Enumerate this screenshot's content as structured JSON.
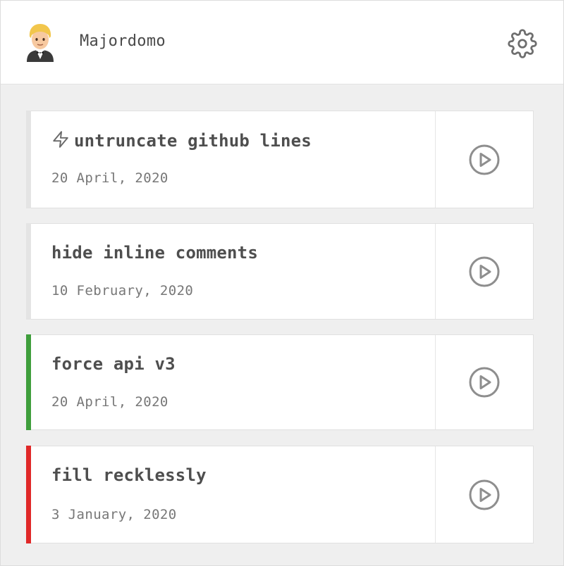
{
  "header": {
    "title": "Majordomo",
    "avatar_icon": "bellhop-person-icon",
    "settings_icon": "gear-icon"
  },
  "colors": {
    "neutral": "#e4e4e4",
    "green": "#3f9e3c",
    "red": "#e02828",
    "icon": "#8e8e8e"
  },
  "scripts": [
    {
      "name": "untruncate github lines",
      "date": "20 April, 2020",
      "status": "neutral",
      "icon": "lightning-bolt-icon"
    },
    {
      "name": "hide inline comments",
      "date": "10 February, 2020",
      "status": "neutral"
    },
    {
      "name": "force api v3",
      "date": "20 April, 2020",
      "status": "green"
    },
    {
      "name": "fill recklessly",
      "date": "3 January, 2020",
      "status": "red"
    }
  ],
  "actions": {
    "run_icon": "play-circle-icon"
  }
}
